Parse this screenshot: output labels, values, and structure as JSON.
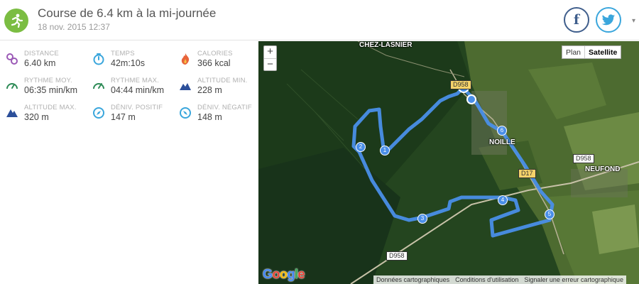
{
  "header": {
    "title": "Course de 6.4 km à la mi-journée",
    "date": "18 nov. 2015 12:37",
    "logo_icon": "running-person-icon",
    "accent": "#7bbd42",
    "share": {
      "facebook_icon": "facebook-icon",
      "twitter_icon": "twitter-icon",
      "more_icon": "chevron-down-icon"
    }
  },
  "stats": [
    {
      "label": "DISTANCE",
      "value": "6.40 km",
      "icon": "distance-icon",
      "color": "#9b59b6"
    },
    {
      "label": "TEMPS",
      "value": "42m:10s",
      "icon": "stopwatch-icon",
      "color": "#3aa6dc"
    },
    {
      "label": "CALORIES",
      "value": "366 kcal",
      "icon": "flame-icon",
      "color": "#e8643a"
    },
    {
      "label": "RYTHME MOY.",
      "value": "06:35 min/km",
      "icon": "gauge-icon",
      "color": "#2e8b57"
    },
    {
      "label": "RYTHME MAX.",
      "value": "04:44 min/km",
      "icon": "gauge-icon",
      "color": "#2e8b57"
    },
    {
      "label": "ALTITUDE MIN.",
      "value": "228 m",
      "icon": "mountain-icon",
      "color": "#2c4f9a"
    },
    {
      "label": "ALTITUDE MAX.",
      "value": "320 m",
      "icon": "mountain-icon",
      "color": "#2c4f9a"
    },
    {
      "label": "DÉNIV. POSITIF",
      "value": "147 m",
      "icon": "compass-icon",
      "color": "#3aa6dc"
    },
    {
      "label": "DÉNIV. NÉGATIF",
      "value": "148 m",
      "icon": "compass-icon",
      "color": "#3aa6dc"
    }
  ],
  "map": {
    "zoom_in": "+",
    "zoom_out": "−",
    "map_types": [
      "Plan",
      "Satellite"
    ],
    "active_type": "Satellite",
    "places": [
      "CHEZ-LASNIER",
      "NOILLE",
      "NEUFOND"
    ],
    "roads": [
      "D958",
      "D958",
      "D17",
      "D958"
    ],
    "km_markers": [
      "1",
      "2",
      "3",
      "4",
      "5",
      "6"
    ],
    "start_icon": "location-pin-icon",
    "brand": "Google",
    "footer": [
      "Données cartographiques",
      "Conditions d'utilisation",
      "Signaler une erreur cartographique"
    ],
    "route_color": "#4a8fe8"
  }
}
